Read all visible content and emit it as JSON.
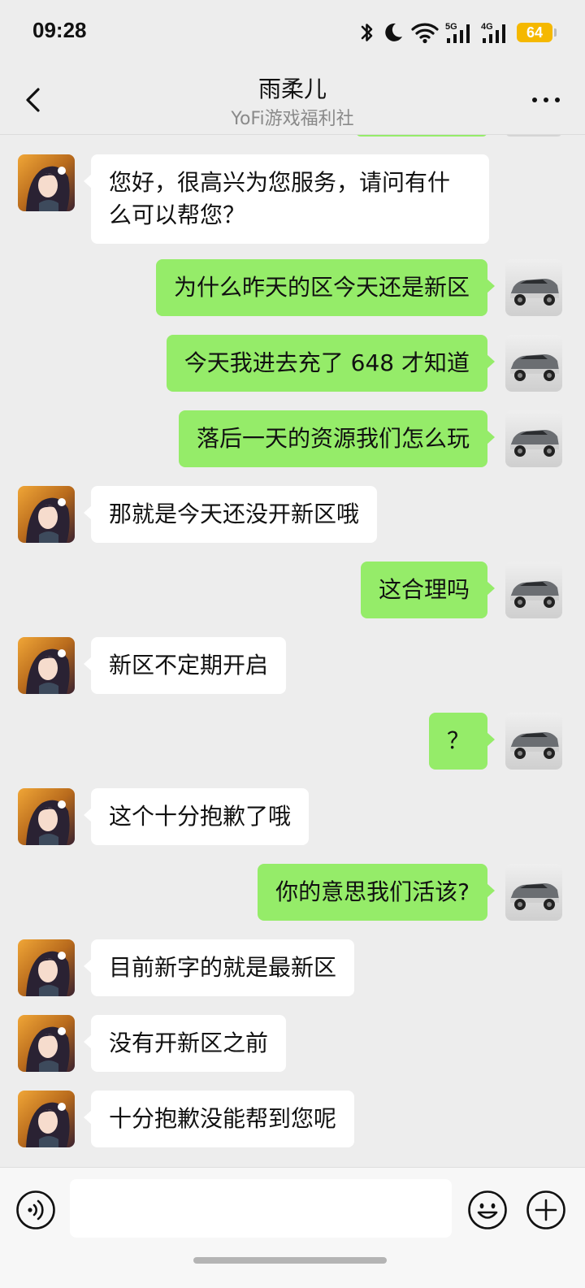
{
  "status_bar": {
    "time": "09:28",
    "battery": "64",
    "icons": [
      "bluetooth-icon",
      "moon-icon",
      "wifi-icon",
      "signal-5g-icon",
      "signal-4g-icon",
      "battery-icon"
    ],
    "battery_color": "#f5b800"
  },
  "header": {
    "title": "雨柔儿",
    "subtitle": "YoFi游戏福利社",
    "back_icon": "chevron-left-icon",
    "more_icon": "more-dots-icon"
  },
  "colors": {
    "background": "#ededed",
    "sent_bubble": "#95ec69",
    "received_bubble": "#ffffff"
  },
  "messages": [
    {
      "side": "left",
      "text": "您好，很高兴为您服务，请问有什\n么可以帮您？"
    },
    {
      "side": "right",
      "text": "为什么昨天的区今天还是新区"
    },
    {
      "side": "right",
      "text": "今天我进去充了 648 才知道"
    },
    {
      "side": "right",
      "text": "落后一天的资源我们怎么玩"
    },
    {
      "side": "left",
      "text": "那就是今天还没开新区哦"
    },
    {
      "side": "right",
      "text": "这合理吗"
    },
    {
      "side": "left",
      "text": "新区不定期开启"
    },
    {
      "side": "right",
      "text": "？"
    },
    {
      "side": "left",
      "text": "这个十分抱歉了哦"
    },
    {
      "side": "right",
      "text": "你的意思我们活该?"
    },
    {
      "side": "left",
      "text": "目前新字的就是最新区"
    },
    {
      "side": "left",
      "text": "没有开新区之前"
    },
    {
      "side": "left",
      "text": "十分抱歉没能帮到您呢"
    }
  ],
  "input_bar": {
    "placeholder": "",
    "voice_icon": "voice-icon",
    "emoji_icon": "emoji-icon",
    "plus_icon": "plus-icon"
  }
}
